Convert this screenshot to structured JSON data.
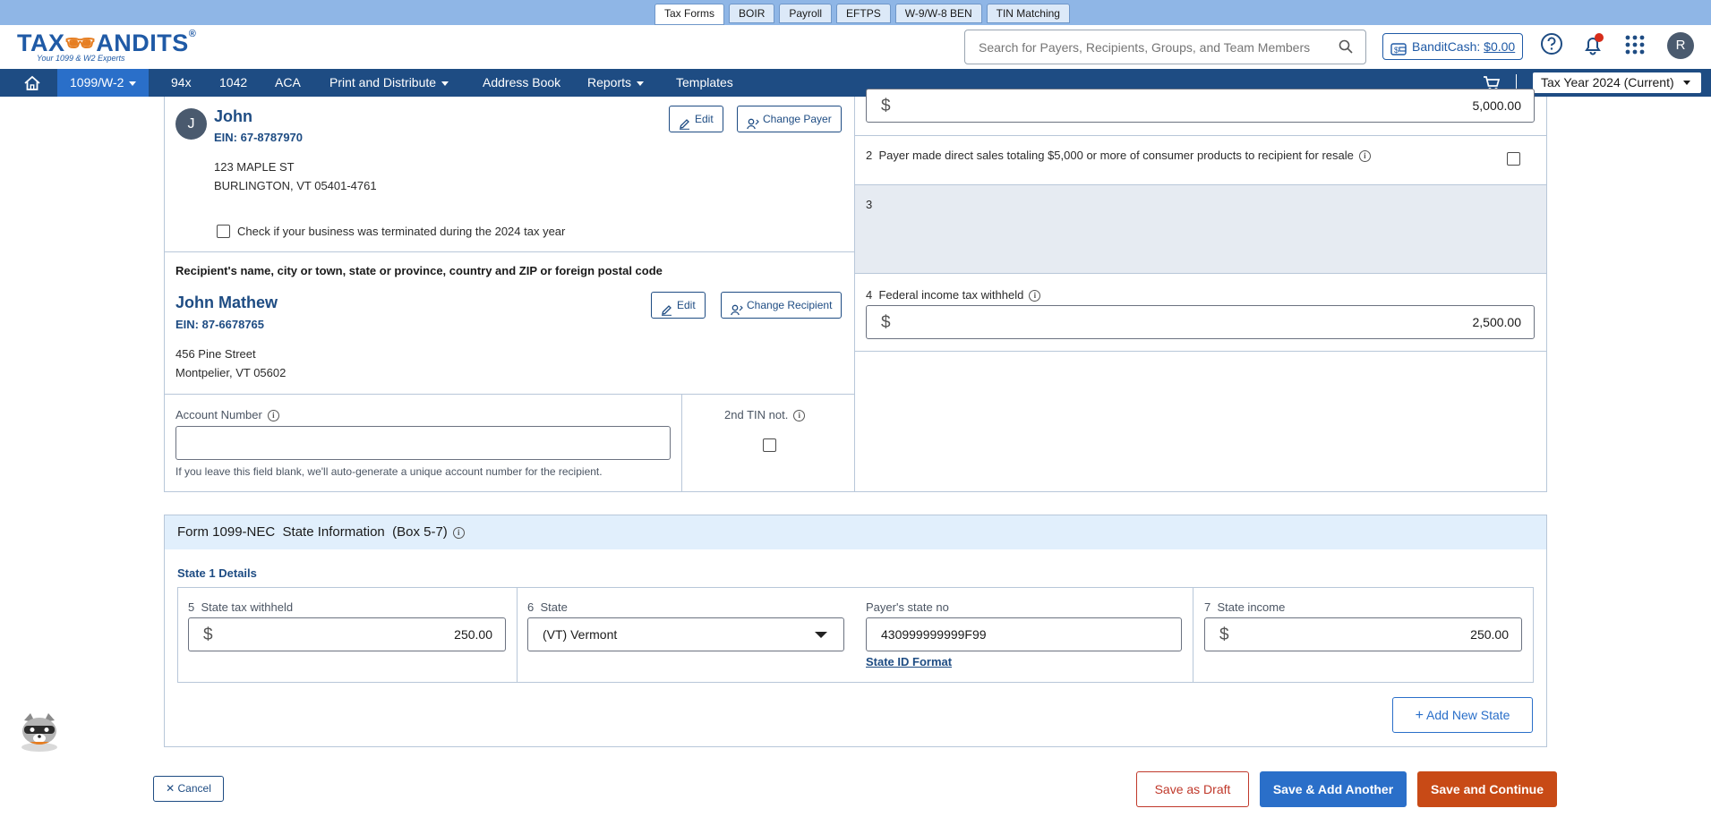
{
  "top_tabs": [
    "Tax Forms",
    "BOIR",
    "Payroll",
    "EFTPS",
    "W-9/W-8 BEN",
    "TIN Matching"
  ],
  "logo": {
    "brand": "TAXBANDITS",
    "tagline": "Your 1099 & W2 Experts"
  },
  "search": {
    "placeholder": "Search for Payers, Recipients, Groups, and Team Members"
  },
  "bandit_cash": {
    "label": "BanditCash:",
    "amount": "$0.00"
  },
  "user_initial": "R",
  "nav": {
    "items": [
      "1099/W-2",
      "94x",
      "1042",
      "ACA",
      "Print and Distribute",
      "Address Book",
      "Reports",
      "Templates"
    ],
    "tax_year": "Tax Year 2024 (Current)"
  },
  "payer": {
    "initial": "J",
    "name": "John",
    "ein": "EIN: 67-8787970",
    "address_line1": "123 MAPLE ST",
    "address_line2": "BURLINGTON, VT 05401-4761",
    "edit_label": "Edit",
    "change_label": "Change Payer",
    "terminated_label": "Check if your business was terminated during the 2024 tax year"
  },
  "recipient": {
    "heading": "Recipient's name, city or town, state or province, country and ZIP or foreign postal code",
    "name": "John Mathew",
    "ein": "EIN: 87-6678765",
    "address_line1": "456 Pine Street",
    "address_line2": "Montpelier, VT 05602",
    "edit_label": "Edit",
    "change_label": "Change Recipient"
  },
  "account": {
    "label": "Account Number",
    "value": "",
    "hint": "If you leave this field blank, we'll auto-generate a unique account number for the recipient.",
    "tin_label": "2nd TIN not."
  },
  "boxes": {
    "box1_value": "5,000.00",
    "box2_num": "2",
    "box2_label": "Payer made direct sales totaling $5,000 or more of consumer products to recipient for resale",
    "box3_num": "3",
    "box4_num": "4",
    "box4_label": "Federal income tax withheld",
    "box4_value": "2,500.00",
    "currency": "$"
  },
  "state": {
    "title": "Form 1099-NEC  State Information  (Box 5-7)",
    "subtitle": "State 1 Details",
    "box5_num": "5",
    "box5_label": "State tax withheld",
    "box5_value": "250.00",
    "box6_num": "6",
    "box6_label": "State",
    "box6_value": "(VT) Vermont",
    "payer_state_no_label": "Payer's state no",
    "payer_state_no_value": "430999999999F99",
    "state_id_link": "State ID Format",
    "box7_num": "7",
    "box7_label": "State income",
    "box7_value": "250.00",
    "add_state_label": "Add New State"
  },
  "footer": {
    "cancel": "Cancel",
    "save_draft": "Save as Draft",
    "save_add_another": "Save & Add Another",
    "save_continue": "Save and Continue"
  },
  "colors": {
    "nav_bg": "#1e4c83",
    "nav_active": "#2a6fc9",
    "primary_blue": "#2a6fc9",
    "continue_orange": "#c84a16",
    "draft_red": "#c0392b"
  }
}
